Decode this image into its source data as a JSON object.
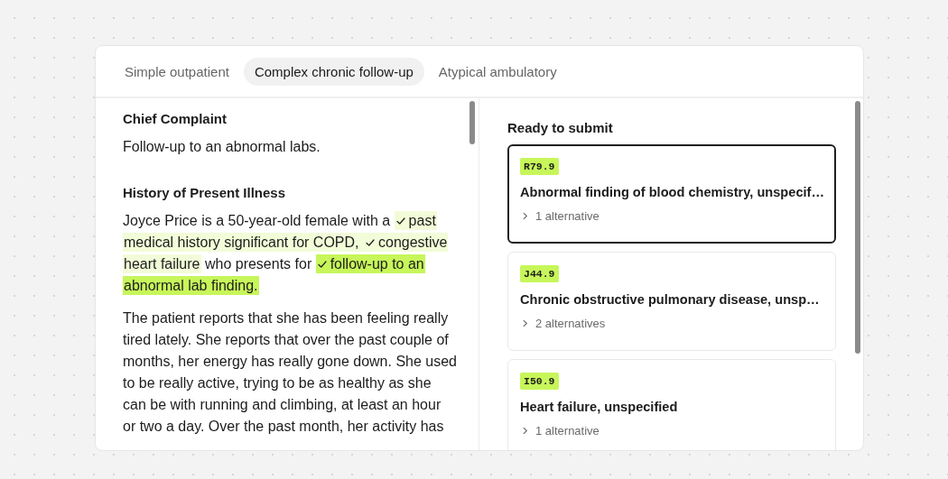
{
  "tabs": [
    {
      "label": "Simple outpatient",
      "selected": false
    },
    {
      "label": "Complex chronic follow-up",
      "selected": true
    },
    {
      "label": "Atypical ambulatory",
      "selected": false
    }
  ],
  "note": {
    "sections": [
      {
        "heading": "Chief Complaint",
        "paragraphs": [
          [
            {
              "text": "Follow-up to an abnormal labs.",
              "kind": "plain"
            }
          ]
        ]
      },
      {
        "heading": "History of Present Illness",
        "paragraphs": [
          [
            {
              "text": "Joyce Price is a 50-year-old female with a ",
              "kind": "plain"
            },
            {
              "text": "past medical history significant for COPD, ",
              "kind": "soft"
            },
            {
              "text": "congestive heart failure",
              "kind": "soft"
            },
            {
              "text": " who presents for ",
              "kind": "plain"
            },
            {
              "text": "follow-up to an abnormal lab finding.",
              "kind": "strong"
            }
          ],
          [
            {
              "text": "The patient reports that she has been feeling really tired lately. She reports that over the past couple of months, her energy has really gone down. She used to be really active, trying to be as healthy as she can be with running and climbing, at least an hour or two a day. Over the past month, her activity has",
              "kind": "plain"
            }
          ]
        ]
      }
    ]
  },
  "codes": {
    "title": "Ready to submit",
    "items": [
      {
        "code": "R79.9",
        "description": "Abnormal finding of blood chemistry, unspecif…",
        "alternatives": "1 alternative",
        "selected": true
      },
      {
        "code": "J44.9",
        "description": "Chronic obstructive pulmonary disease, unsp…",
        "alternatives": "2 alternatives",
        "selected": false
      },
      {
        "code": "I50.9",
        "description": "Heart failure, unspecified",
        "alternatives": "1 alternative",
        "selected": false
      }
    ]
  }
}
